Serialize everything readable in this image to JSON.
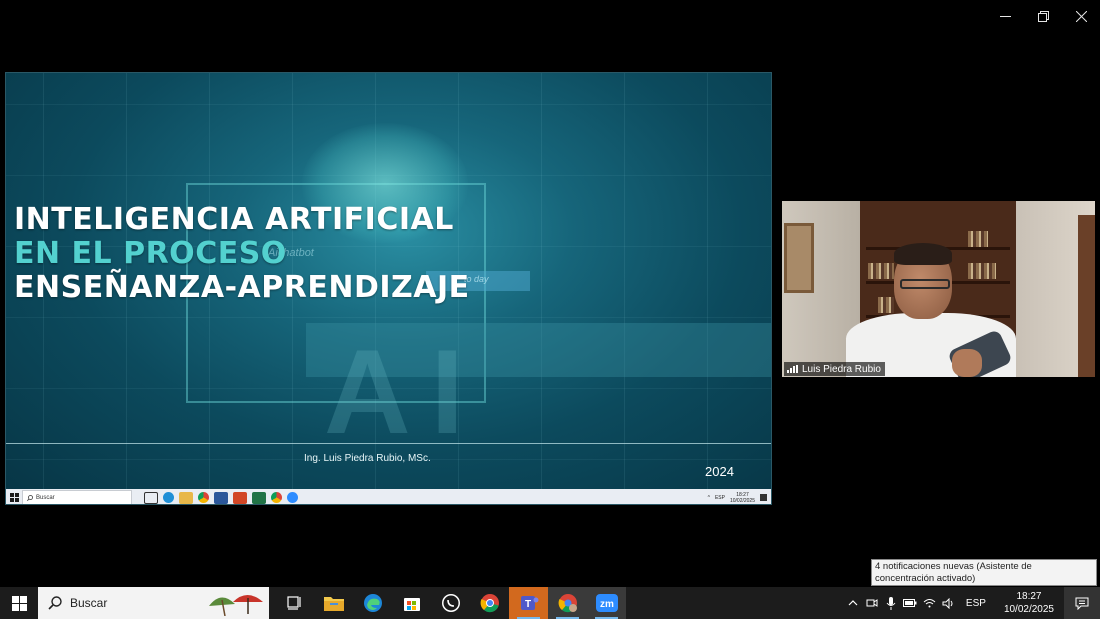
{
  "window": {
    "controls": [
      "minimize",
      "restore",
      "close"
    ]
  },
  "slide": {
    "title_line1": "INTELIGENCIA ARTIFICIAL",
    "title_line2": "EN EL PROCESO",
    "title_line3": "ENSEÑANZA-APRENDIZAJE",
    "background_tag1": "Aichatbot",
    "background_tag2": "to day",
    "author": "Ing. Luis Piedra Rubio, MSc.",
    "year": "2024"
  },
  "inner_taskbar": {
    "search_text": "Buscar",
    "lang": "ESP",
    "time": "18:27",
    "date": "10/02/2025"
  },
  "video": {
    "participant_name": "Luis Piedra Rubio"
  },
  "notification": {
    "text": "4 notificaciones nuevas (Asistente de concentración activado)"
  },
  "taskbar": {
    "search_text": "Buscar",
    "apps": [
      "task-view",
      "file-explorer",
      "edge",
      "microsoft-store",
      "whatsapp",
      "chrome",
      "teams",
      "chrome-profile",
      "zoom"
    ],
    "zoom_label": "zm",
    "teams_label": "T",
    "lang": "ESP",
    "time": "18:27",
    "date": "10/02/2025"
  },
  "colors": {
    "accent_title": "#53d1cf",
    "slide_bg": "#0c4a5d",
    "taskbar_bg": "#1c1c1c"
  }
}
